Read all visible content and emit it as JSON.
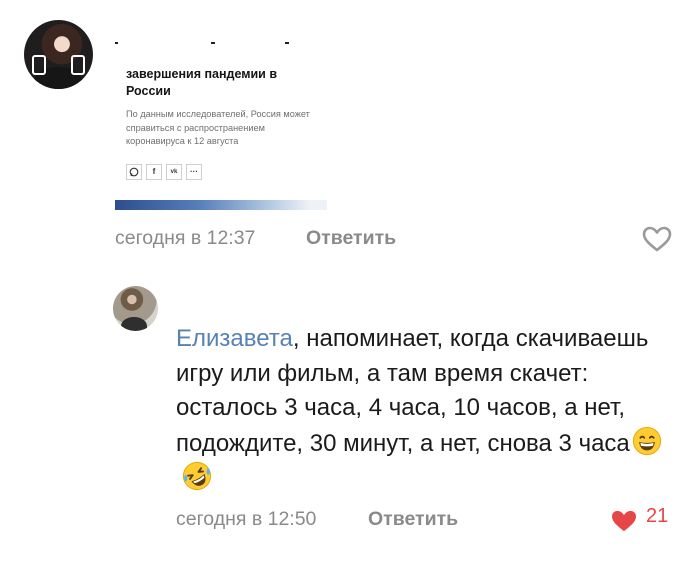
{
  "comment1": {
    "article": {
      "headline": "завершения пандемии в России",
      "lead": "По данным исследователей, Россия может справиться с распространением коронавируса к 12 августа",
      "share_icons": [
        "whatsapp-icon",
        "facebook-icon",
        "vk-icon",
        "more-icon"
      ],
      "share_labels": {
        "facebook": "f",
        "vk": "vk",
        "more": "···"
      }
    },
    "timestamp": "сегодня в 12:37",
    "reply_label": "Ответить"
  },
  "comment2": {
    "mention": "Елизавета",
    "text": ", напоминает, когда скачиваешь игру или фильм, а там время скачет: осталось 3 часа, 4 часа, 10 часов, а нет, подождите, 30 минут, а нет, снова 3 часа",
    "emojis": [
      "grinning-face-emoji",
      "rolling-on-floor-laughing-emoji"
    ],
    "timestamp": "сегодня в 12:50",
    "reply_label": "Ответить",
    "likes": "21"
  },
  "colors": {
    "mention": "#5782b4",
    "meta": "#8a8a8a",
    "like_active": "#e64646"
  }
}
